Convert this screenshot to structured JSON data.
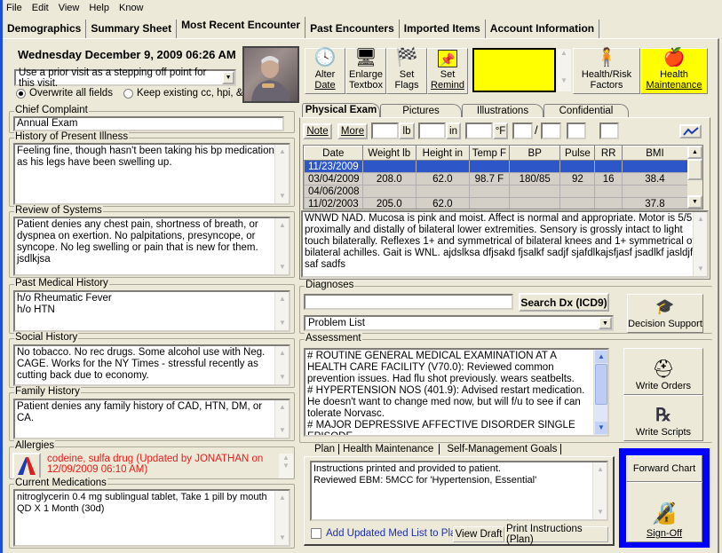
{
  "menu": [
    "File",
    "Edit",
    "View",
    "Help",
    "Know"
  ],
  "tabs": [
    {
      "label": "Demographics",
      "active": false
    },
    {
      "label": "Summary Sheet",
      "active": false
    },
    {
      "label": "Most Recent Encounter",
      "active": true
    },
    {
      "label": "Past Encounters",
      "active": false
    },
    {
      "label": "Imported Items",
      "active": false
    },
    {
      "label": "Account Information",
      "active": false
    }
  ],
  "encounter": {
    "datetime": "Wednesday December 9, 2009  06:26 AM",
    "prior_visit_select": "Use a prior visit as a stepping off point for this visit.",
    "radio_overwrite": "Overwrite all fields",
    "radio_keep": "Keep existing cc, hpi, & ros",
    "selected_radio": "overwrite"
  },
  "toolbar": {
    "alter_date": [
      "Alter",
      "Date"
    ],
    "enlarge_textbox": [
      "Enlarge",
      "Textbox"
    ],
    "set_flags": [
      "Set",
      "Flags"
    ],
    "set_remind": [
      "Set",
      "Remind"
    ],
    "health_risk": [
      "Health/Risk",
      "Factors"
    ],
    "health_maintenance": [
      "Health",
      "Maintenance"
    ],
    "highlight_color": "#ffff00"
  },
  "left": {
    "chief_complaint_label": "Chief Complaint",
    "chief_complaint": "Annual Exam",
    "hpi_label": "History of Present Illness",
    "hpi": "Feeling fine, though hasn't been taking his bp medication as his legs have been swelling up.",
    "ros_label": "Review of Systems",
    "ros": "Patient denies any chest pain, shortness of breath, or dyspnea on exertion. No palpitations, presyncope, or syncope. No leg swelling or pain that is new for them. jsdlkjsa",
    "pmh_label": "Past Medical History",
    "pmh": [
      "h/o Rheumatic Fever",
      "h/o HTN"
    ],
    "social_label": "Social History",
    "social": "No tobacco. No rec drugs. Some alcohol use with Neg. CAGE. Works for the NY Times - stressful recently as cutting back due to economy.",
    "family_label": "Family History",
    "family": "Patient denies any family history of CAD, HTN, DM, or CA.",
    "allergies_label": "Allergies",
    "allergies": "codeine, sulfa drug (Updated by JONATHAN on 12/09/2009 06:10 AM)",
    "meds_label": "Current Medications",
    "meds": "nitroglycerin 0.4 mg sublingual tablet, Take 1 pill by mouth QD X 1 Month (30d)"
  },
  "exam": {
    "subtabs": [
      "Physical Exam",
      "Pictures",
      "Illustrations",
      "Confidential"
    ],
    "note_btn": "Note",
    "more_btn": "More",
    "unit_lb": "lb",
    "unit_in": "in",
    "unit_f": "°F",
    "bp_sep": "/",
    "columns": [
      "Date",
      "Weight lb",
      "Height in",
      "Temp F",
      "BP",
      "Pulse",
      "RR",
      "BMI"
    ],
    "rows": [
      [
        "11/23/2009",
        "",
        "",
        "",
        "",
        "",
        "",
        ""
      ],
      [
        "03/04/2009",
        "208.0",
        "62.0",
        "98.7 F",
        "180/85",
        "92",
        "16",
        "38.4"
      ],
      [
        "04/06/2008",
        "",
        "",
        "",
        "",
        "",
        "",
        ""
      ],
      [
        "11/02/2003",
        "205.0",
        "62.0",
        "",
        "",
        "",
        "",
        "37.8"
      ]
    ],
    "selected_row": 0,
    "notes": "WNWD NAD. Mucosa is pink and moist. Affect is normal and appropriate. Motor is 5/5 proximally and distally of bilateral lower extremities. Sensory is grossly intact to light touch bilaterally. Reflexes 1+ and symmetrical of bilateral knees and 1+ symmetrical of bilateral achilles. Gait is WNL. ajdslksa dfjsakd fjsalkf sadjf sjafdlkajsfjasf jsadlkf jasldjf saf sadfs"
  },
  "diagnoses": {
    "label": "Diagnoses",
    "search_value": "",
    "search_btn": "Search Dx (ICD9)",
    "problem_list": "Problem List",
    "decision_support": "Decision Support"
  },
  "assessment": {
    "label": "Assessment",
    "lines": [
      "# ROUTINE GENERAL MEDICAL EXAMINATION AT A HEALTH CARE FACILITY (V70.0): Reviewed common prevention issues. Had flu shot previously. wears seatbelts.",
      "# HYPERTENSION NOS (401.9): Advised restart medication. He doesn't want to change med now, but will f/u to see if can tolerate Norvasc.",
      "# MAJOR DEPRESSIVE AFFECTIVE DISORDER SINGLE EPISODE"
    ],
    "write_orders": "Write Orders",
    "write_scripts": "Write Scripts"
  },
  "plan": {
    "tabs": [
      "Plan",
      "Health Maintenance",
      "Self-Management Goals"
    ],
    "lines": [
      "Instructions printed and provided to patient.",
      "Reviewed EBM: 5MCC for 'Hypertension, Essential'"
    ],
    "add_med_list": "Add Updated Med List to Plan",
    "add_med_checked": false,
    "view_draft": "View Draft",
    "print_instructions": "Print Instructions (Plan)",
    "forward_chart": "Forward Chart",
    "sign_off": "Sign-Off",
    "signoff_border_color": "#0000ff"
  }
}
